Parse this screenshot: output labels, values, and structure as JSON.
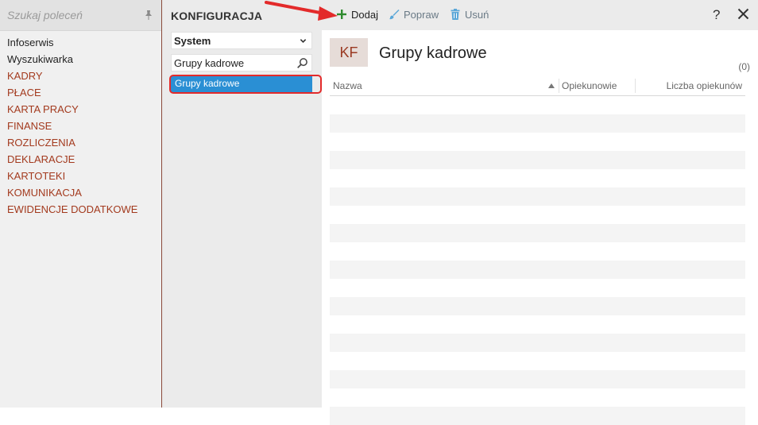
{
  "sidebar": {
    "search_placeholder": "Szukaj poleceń",
    "items": [
      {
        "label": "Infoserwis",
        "kind": "plain"
      },
      {
        "label": "Wyszukiwarka",
        "kind": "plain"
      },
      {
        "label": "KADRY",
        "kind": "section"
      },
      {
        "label": "PŁACE",
        "kind": "section"
      },
      {
        "label": "KARTA PRACY",
        "kind": "section"
      },
      {
        "label": "FINANSE",
        "kind": "section"
      },
      {
        "label": "ROZLICZENIA",
        "kind": "section"
      },
      {
        "label": "DEKLARACJE",
        "kind": "section"
      },
      {
        "label": "KARTOTEKI",
        "kind": "section"
      },
      {
        "label": "KOMUNIKACJA",
        "kind": "section"
      },
      {
        "label": "EWIDENCJE DODATKOWE",
        "kind": "section"
      }
    ]
  },
  "middle": {
    "title": "KONFIGURACJA",
    "selected_group": "System",
    "search_value": "Grupy kadrowe",
    "tree_selected": "Grupy kadrowe"
  },
  "toolbar": {
    "add_label": "Dodaj",
    "edit_label": "Popraw",
    "delete_label": "Usuń",
    "help_label": "?"
  },
  "main": {
    "badge": "KF",
    "title": "Grupy kadrowe",
    "count": "(0)",
    "columns": [
      "Nazwa",
      "Opiekunowie",
      "Liczba opiekunów"
    ]
  },
  "colors": {
    "accent_blue": "#2a8fd4",
    "section_red": "#a33a1e",
    "add_green": "#2e8b2e",
    "highlight_red": "#e32a2a"
  }
}
